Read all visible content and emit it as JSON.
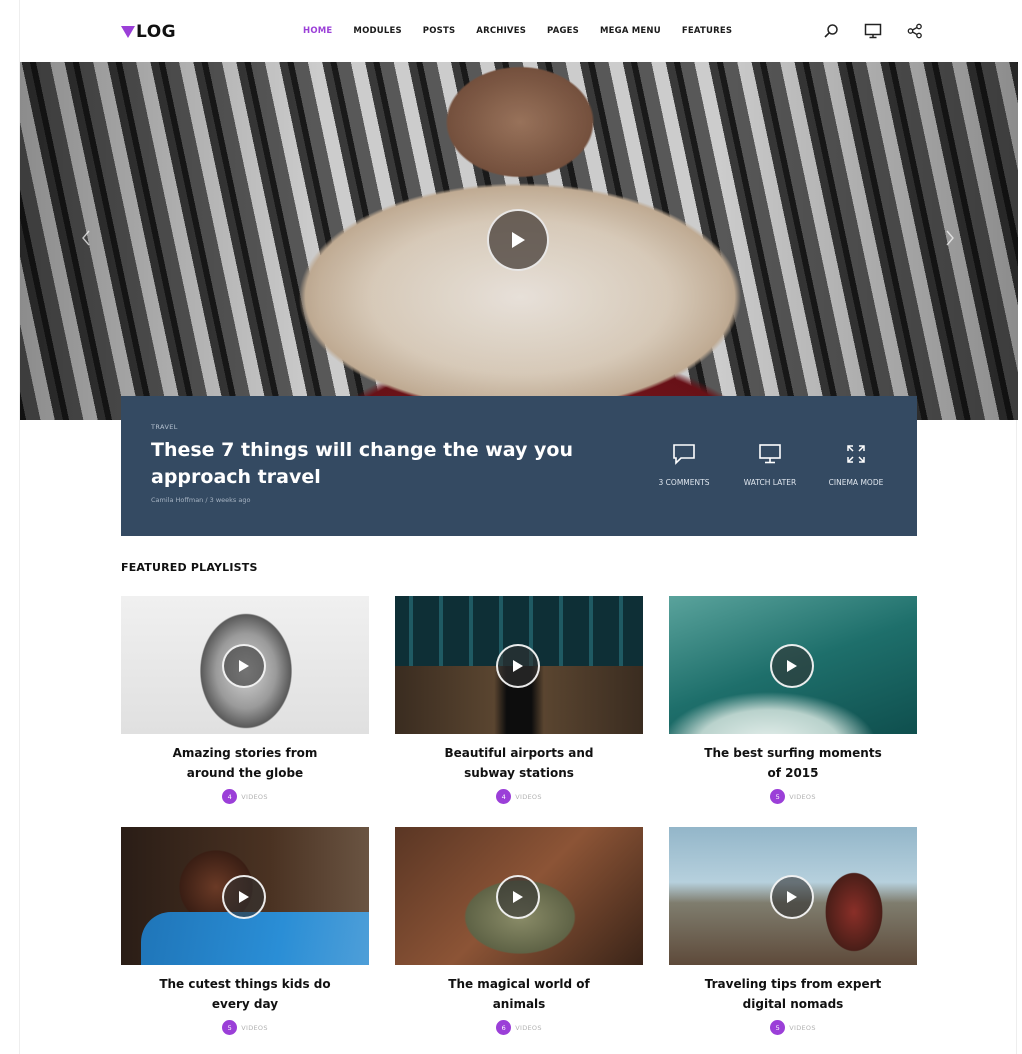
{
  "header": {
    "logo_text": "LOG",
    "nav": [
      {
        "label": "HOME",
        "active": true
      },
      {
        "label": "MODULES",
        "active": false
      },
      {
        "label": "POSTS",
        "active": false
      },
      {
        "label": "ARCHIVES",
        "active": false
      },
      {
        "label": "PAGES",
        "active": false
      },
      {
        "label": "MEGA MENU",
        "active": false
      },
      {
        "label": "FEATURES",
        "active": false
      }
    ],
    "icons": [
      "search-icon",
      "monitor-icon",
      "share-icon"
    ]
  },
  "hero": {
    "category": "TRAVEL",
    "title": "These 7 things will change the way you approach travel",
    "author": "Camila Hoffman",
    "time_ago": "3 weeks ago",
    "actions": [
      {
        "icon": "comment-icon",
        "label": "3 COMMENTS"
      },
      {
        "icon": "monitor-icon",
        "label": "WATCH LATER"
      },
      {
        "icon": "expand-icon",
        "label": "CINEMA MODE"
      }
    ]
  },
  "playlists": {
    "section_title": "FEATURED PLAYLISTS",
    "videos_label": "VIDEOS",
    "items": [
      {
        "title": "Amazing stories from around the globe",
        "count": "4"
      },
      {
        "title": "Beautiful airports and subway stations",
        "count": "4"
      },
      {
        "title": "The best surfing moments of 2015",
        "count": "5"
      },
      {
        "title": "The cutest things kids do every day",
        "count": "5"
      },
      {
        "title": "The magical world of animals",
        "count": "6"
      },
      {
        "title": "Traveling tips from expert digital nomads",
        "count": "5"
      }
    ]
  },
  "colors": {
    "accent": "#9b3fd8",
    "panel": "#344a62"
  }
}
